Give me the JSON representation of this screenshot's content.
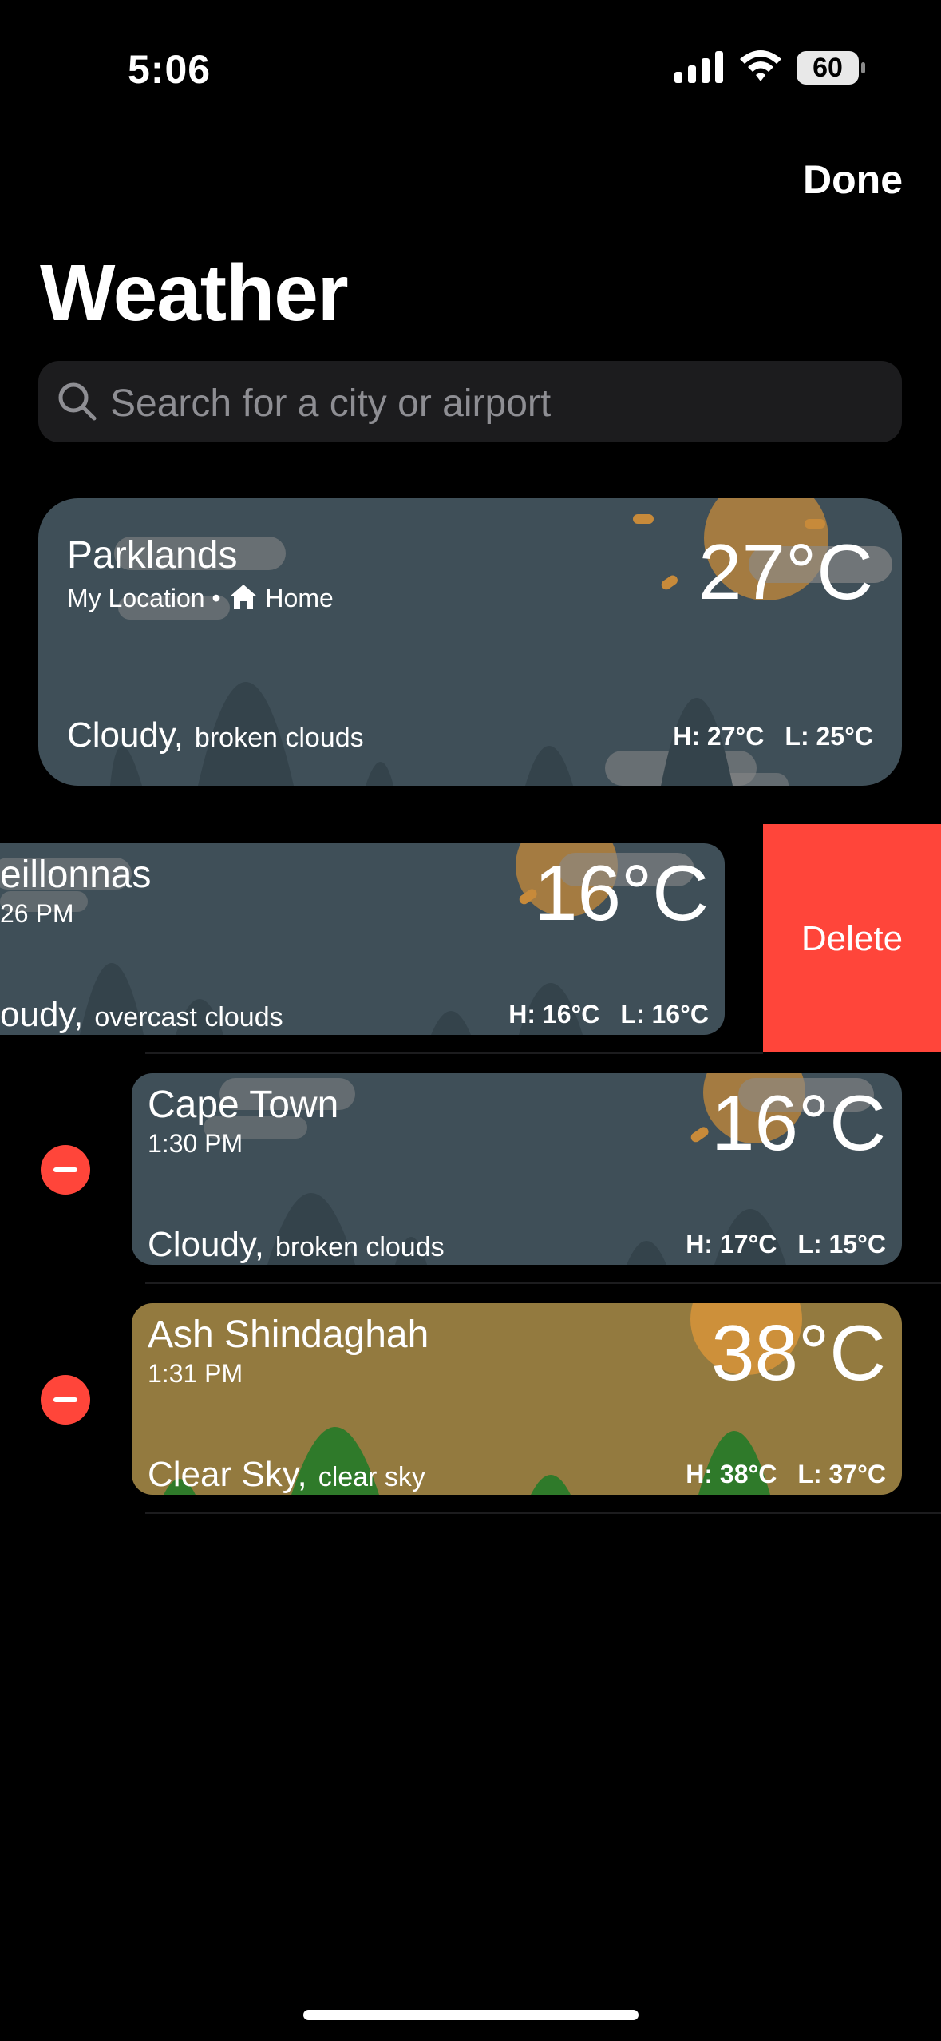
{
  "status_bar": {
    "time": "5:06",
    "battery": "60"
  },
  "header": {
    "done_label": "Done",
    "title": "Weather"
  },
  "search": {
    "placeholder": "Search for a city or airport"
  },
  "cities": [
    {
      "name": "Parklands",
      "subtitle_location": "My Location",
      "subtitle_home": "Home",
      "temp": "27°C",
      "condition": "Cloudy,",
      "description": "broken clouds",
      "high": "H: 27°C",
      "low": "L: 25°C"
    },
    {
      "name": "eillonnas",
      "subtitle": "26 PM",
      "temp": "16°C",
      "condition": "oudy,",
      "description": "overcast clouds",
      "high": "H: 16°C",
      "low": "L: 16°C"
    },
    {
      "name": "Cape Town",
      "subtitle": "1:30 PM",
      "temp": "16°C",
      "condition": "Cloudy,",
      "description": "broken clouds",
      "high": "H: 17°C",
      "low": "L: 15°C"
    },
    {
      "name": "Ash Shindaghah",
      "subtitle": "1:31 PM",
      "temp": "38°C",
      "condition": "Clear Sky,",
      "description": "clear sky",
      "high": "H: 38°C",
      "low": "L: 37°C"
    }
  ],
  "delete_label": "Delete",
  "colors": {
    "cloudy_card": "#3f4f58",
    "clear_card": "#937a3f",
    "delete": "#ff453a",
    "sun": "#d4923a"
  }
}
